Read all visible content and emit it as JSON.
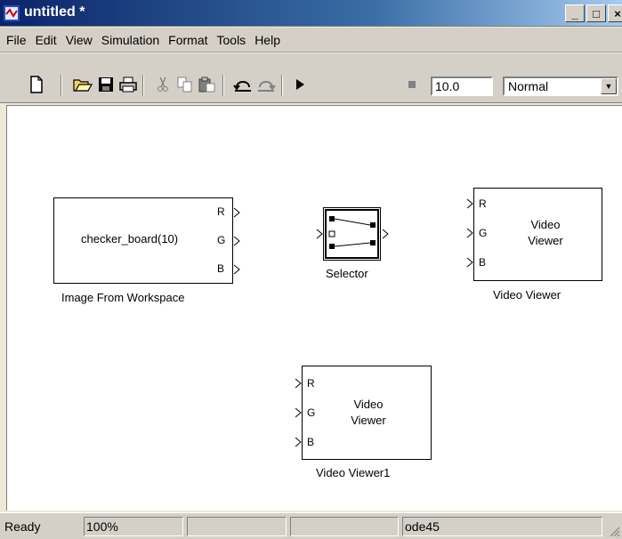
{
  "window": {
    "title": "untitled *",
    "minimize_glyph": "_",
    "maximize_glyph": "□",
    "close_glyph": "×"
  },
  "menu": [
    "File",
    "Edit",
    "View",
    "Simulation",
    "Format",
    "Tools",
    "Help"
  ],
  "toolbar": {
    "stop_time": "10.0",
    "sim_mode": "Normal",
    "icons": [
      "new-file-icon",
      "open-folder-icon",
      "save-icon",
      "print-icon",
      "cut-icon",
      "copy-icon",
      "paste-icon",
      "undo-icon",
      "redo-icon",
      "play-icon",
      "stop-icon"
    ]
  },
  "blocks": {
    "image_from_workspace": {
      "text": "checker_board(10)",
      "ports": [
        "R",
        "G",
        "B"
      ],
      "caption": "Image From Workspace"
    },
    "selector": {
      "caption": "Selector"
    },
    "video_viewer": {
      "line1": "Video",
      "line2": "Viewer",
      "ports": [
        "R",
        "G",
        "B"
      ],
      "caption": "Video Viewer"
    },
    "video_viewer1": {
      "line1": "Video",
      "line2": "Viewer",
      "ports": [
        "R",
        "G",
        "B"
      ],
      "caption": "Video Viewer1"
    }
  },
  "status": {
    "state": "Ready",
    "zoom": "100%",
    "cell3": "",
    "cell4": "",
    "solver": "ode45"
  }
}
